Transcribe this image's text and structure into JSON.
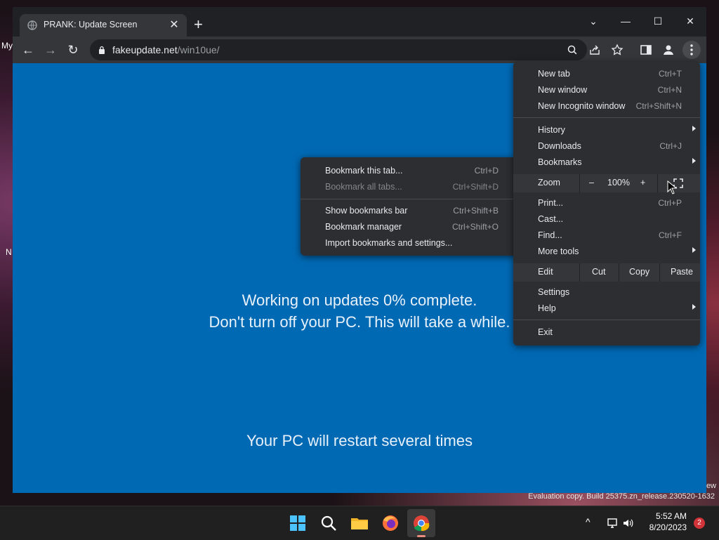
{
  "desktop": {
    "label_top": "My",
    "label_mid": "N",
    "label_right": "ew",
    "watermark": "Evaluation copy. Build 25375.zn_release.230520-1632"
  },
  "browser": {
    "tab": {
      "title": "PRANK: Update Screen",
      "close_glyph": "✕"
    },
    "newtab_glyph": "+",
    "window": {
      "tabsearch_glyph": "⌄",
      "minimize_glyph": "—",
      "maximize_glyph": "☐",
      "close_glyph": "✕"
    },
    "nav": {
      "back_glyph": "←",
      "forward_glyph": "→",
      "reload_glyph": "↻"
    },
    "omnibox": {
      "domain": "fakeupdate.net",
      "path": "/win10ue/"
    },
    "colors": {
      "page_bg": "#0069b4",
      "menu_bg": "#2d2e31",
      "accent": "#e8eaed"
    }
  },
  "page": {
    "line1": "Working on updates  0% complete.",
    "line2": "Don't turn off your PC. This will take a while.",
    "line3": "Your PC will restart several times"
  },
  "chrome_menu": {
    "new_tab": {
      "label": "New tab",
      "shortcut": "Ctrl+T"
    },
    "new_window": {
      "label": "New window",
      "shortcut": "Ctrl+N"
    },
    "incognito": {
      "label": "New Incognito window",
      "shortcut": "Ctrl+Shift+N"
    },
    "history": {
      "label": "History"
    },
    "downloads": {
      "label": "Downloads",
      "shortcut": "Ctrl+J"
    },
    "bookmarks": {
      "label": "Bookmarks"
    },
    "zoom": {
      "label": "Zoom",
      "minus": "–",
      "value": "100%",
      "plus": "+"
    },
    "print": {
      "label": "Print...",
      "shortcut": "Ctrl+P"
    },
    "cast": {
      "label": "Cast..."
    },
    "find": {
      "label": "Find...",
      "shortcut": "Ctrl+F"
    },
    "more_tools": {
      "label": "More tools"
    },
    "edit": {
      "label": "Edit",
      "cut": "Cut",
      "copy": "Copy",
      "paste": "Paste"
    },
    "settings": {
      "label": "Settings"
    },
    "help": {
      "label": "Help"
    },
    "exit": {
      "label": "Exit"
    }
  },
  "bookmarks_menu": {
    "bookmark_tab": {
      "label": "Bookmark this tab...",
      "shortcut": "Ctrl+D"
    },
    "bookmark_all": {
      "label": "Bookmark all tabs...",
      "shortcut": "Ctrl+Shift+D"
    },
    "show_bar": {
      "label": "Show bookmarks bar",
      "shortcut": "Ctrl+Shift+B"
    },
    "manager": {
      "label": "Bookmark manager",
      "shortcut": "Ctrl+Shift+O"
    },
    "import": {
      "label": "Import bookmarks and settings..."
    }
  },
  "taskbar": {
    "time": "5:52 AM",
    "date": "8/20/2023",
    "notifications": "2",
    "chevron_glyph": "^"
  }
}
